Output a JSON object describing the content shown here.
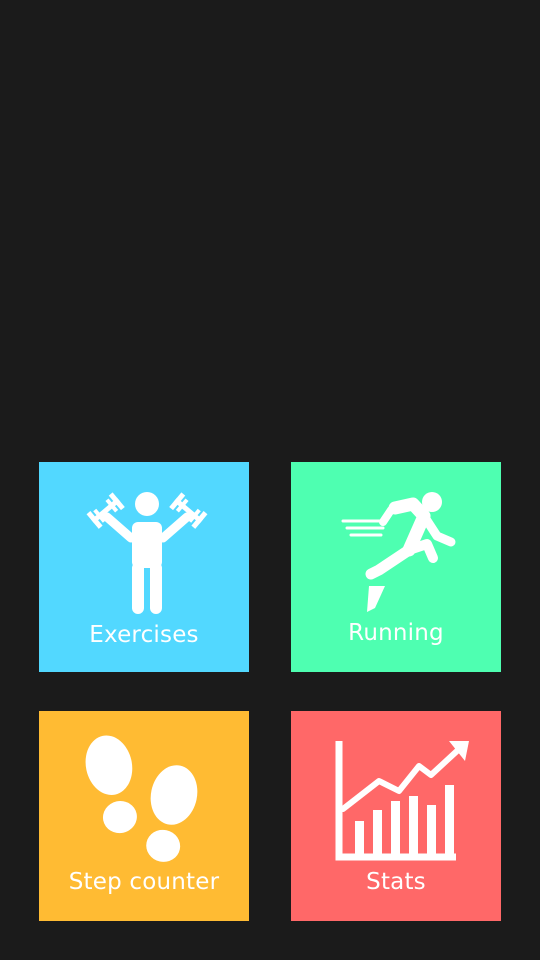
{
  "tiles": [
    {
      "label": "Exercises",
      "icon": "dumbbell-person-icon",
      "color": "#52d8ff"
    },
    {
      "label": "Running",
      "icon": "running-person-icon",
      "color": "#4effb1"
    },
    {
      "label": "Step counter",
      "icon": "footprints-icon",
      "color": "#ffbb33"
    },
    {
      "label": "Stats",
      "icon": "bar-chart-trend-icon",
      "color": "#ff6868"
    }
  ]
}
